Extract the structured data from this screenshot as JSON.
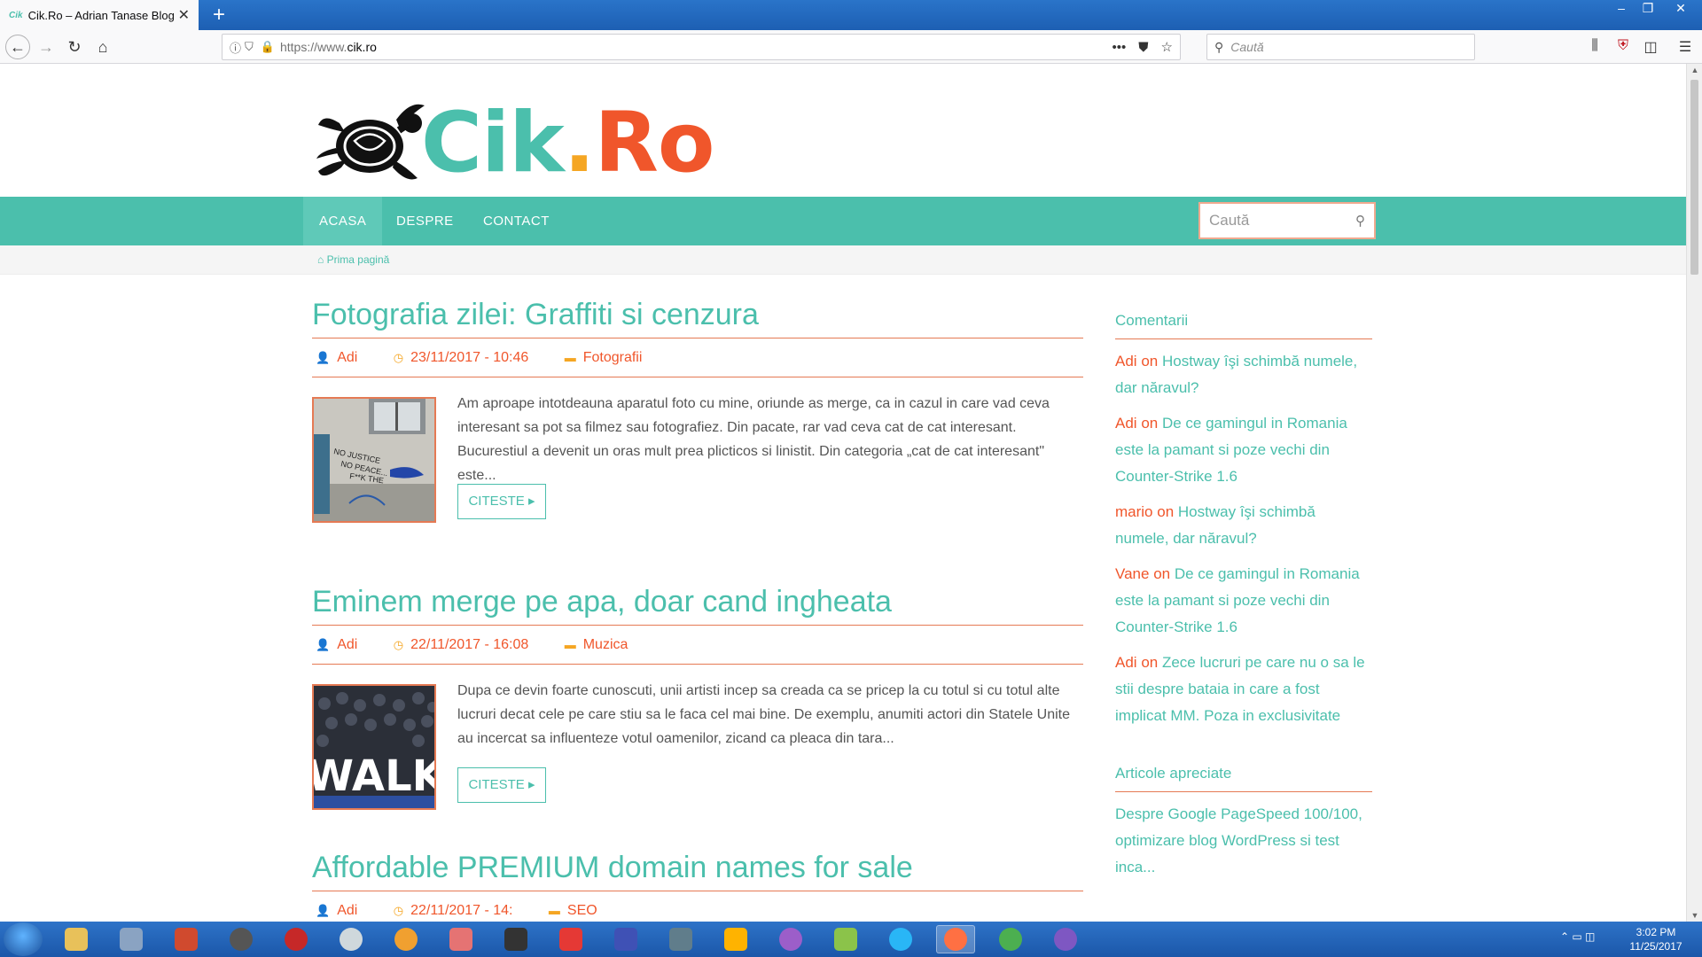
{
  "browser": {
    "tab_favicon_text": "Cik",
    "tab_title": "Cik.Ro – Adrian Tanase Blog",
    "url_prefix": "https://www.",
    "url_domain": "cik.ro",
    "search_placeholder": "Caută",
    "more_icon": "•••"
  },
  "site": {
    "logo_part1": "Cik",
    "logo_dot": ".",
    "logo_part2": "Ro",
    "menu": [
      "ACASA",
      "DESPRE",
      "CONTACT"
    ],
    "search_placeholder": "Caută",
    "breadcrumb": "Prima pagină"
  },
  "posts": [
    {
      "title": "Fotografia zilei: Graffiti si cenzura",
      "author": "Adi",
      "date": "23/11/2017 - 10:46",
      "category": "Fotografii",
      "excerpt": "Am aproape intotdeauna aparatul foto cu mine, oriunde as merge, ca in cazul in care vad ceva interesant sa pot sa filmez sau fotografiez. Din pacate, rar vad ceva cat de cat interesant. Bucurestiul a devenit un oras mult prea plicticos si linistit. Din categoria „cat de cat interesant\" este...",
      "more": "CITESTE",
      "thumb_text": [
        "NO JUSTICE",
        "NO PEACE...",
        "F**K THE"
      ]
    },
    {
      "title": "Eminem merge pe apa, doar cand ingheata",
      "author": "Adi",
      "date": "22/11/2017 - 16:08",
      "category": "Muzica",
      "excerpt": "Dupa ce devin foarte cunoscuti, unii artisti incep sa creada ca se pricep la cu totul si cu totul alte lucruri decat cele pe care stiu sa le faca cel mai bine. De exemplu, anumiti actori din Statele Unite au incercat sa influenteze votul oamenilor, zicand ca pleaca din tara...",
      "more": "CITESTE",
      "thumb_text": "WALK"
    },
    {
      "title": "Affordable PREMIUM domain names for sale",
      "author": "Adi",
      "date": "22/11/2017 - 14:",
      "category": "SEO"
    }
  ],
  "sidebar": {
    "comments_title": "Comentarii",
    "comments": [
      {
        "author": "Adi",
        "on": "on",
        "link": "Hostway îşi schimbă numele, dar năravul?"
      },
      {
        "author": "Adi",
        "on": "on",
        "link": "De ce gamingul in Romania este la pamant si poze vechi din Counter-Strike 1.6"
      },
      {
        "author": "mario",
        "on": "on",
        "link": "Hostway îşi schimbă numele, dar năravul?"
      },
      {
        "author": "Vane",
        "on": "on",
        "link": "De ce gamingul in Romania este la pamant si poze vechi din Counter-Strike 1.6"
      },
      {
        "author": "Adi",
        "on": "on",
        "link": "Zece lucruri pe care nu o sa le stii despre bataia in care a fost implicat MM. Poza in exclusivitate"
      }
    ],
    "liked_title": "Articole apreciate",
    "liked": [
      "Despre Google PageSpeed 100/100, optimizare blog WordPress si test inca..."
    ]
  },
  "taskbar": {
    "time": "3:02 PM",
    "date": "11/25/2017"
  },
  "colors": {
    "accent": "#4bbfac",
    "orange": "#f0562b",
    "gold": "#f5a623"
  }
}
